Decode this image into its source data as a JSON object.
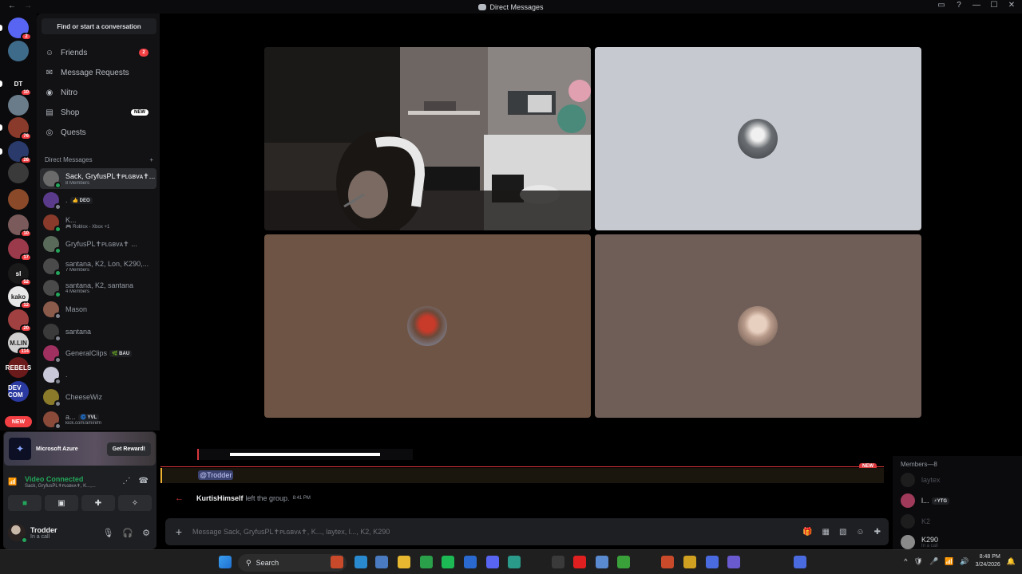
{
  "window": {
    "title": "Direct Messages",
    "back": "←",
    "forward": "→",
    "controls": [
      "▭",
      "?",
      "—",
      "☐",
      "✕"
    ]
  },
  "guilds": [
    {
      "name": "discord-home",
      "label": "",
      "badge": "2",
      "color": "#5865f2"
    },
    {
      "name": "server-globe",
      "label": "",
      "badge": "",
      "color": "#3f6b8a"
    },
    {
      "name": "server-dt",
      "label": "DT",
      "badge": "10",
      "color": "#0b0b0d"
    },
    {
      "name": "server-avatar-a",
      "label": "",
      "badge": "",
      "color": "#6a7c8a"
    },
    {
      "name": "server-avatar-b",
      "label": "",
      "badge": "76",
      "color": "#8a3a2a"
    },
    {
      "name": "server-avatar-c",
      "label": "",
      "badge": "26",
      "color": "#2a3a6a"
    },
    {
      "name": "server-avatar-d",
      "label": "",
      "badge": "",
      "color": "#3a3a3a"
    },
    {
      "name": "server-avatar-e",
      "label": "",
      "badge": "",
      "color": "#8a4a2a"
    },
    {
      "name": "server-avatar-f",
      "label": "",
      "badge": "10",
      "color": "#7a5a5a"
    },
    {
      "name": "server-avatar-g",
      "label": "",
      "badge": "17",
      "color": "#9a3a4a"
    },
    {
      "name": "server-sl",
      "label": "sl",
      "badge": "52",
      "color": "#1a1a1a"
    },
    {
      "name": "server-kako",
      "label": "kako",
      "badge": "12",
      "color": "#e8e8e8"
    },
    {
      "name": "server-avatar-h",
      "label": "",
      "badge": "20",
      "color": "#a04040"
    },
    {
      "name": "server-mlin",
      "label": "M.LIN",
      "badge": "114",
      "color": "#d0d0d0"
    },
    {
      "name": "server-rebels",
      "label": "REBELS",
      "badge": "",
      "color": "#6a1a1a"
    },
    {
      "name": "server-dev-com",
      "label": "DEV COM",
      "badge": "",
      "color": "#2a3aa0"
    }
  ],
  "new_pill": "NEW",
  "sidebar": {
    "find": "Find or start a conversation",
    "nav": [
      {
        "label": "Friends",
        "icon": "friends-icon",
        "count": "2"
      },
      {
        "label": "Message Requests",
        "icon": "mail-icon"
      },
      {
        "label": "Nitro",
        "icon": "nitro-icon"
      },
      {
        "label": "Shop",
        "icon": "shop-icon",
        "tag": "NEW"
      },
      {
        "label": "Quests",
        "icon": "quests-icon"
      }
    ],
    "dm_header": "Direct Messages",
    "dm_add": "+",
    "dms": [
      {
        "name": "Sack, GryfusPL✝ᴘʟɢʙᴠᴀ✝...",
        "sub": "8 Members",
        "tag": "",
        "color": "#6a6a6a",
        "status": "on",
        "active": true
      },
      {
        "name": ".",
        "sub": "",
        "tag": "👍 DEO",
        "color": "#5a3a8a",
        "status": "off"
      },
      {
        "name": "K...",
        "sub": "🎮 Roblox - Xbox +1",
        "tag": "",
        "color": "#8a3a2a",
        "status": "on"
      },
      {
        "name": "GryfusPL✝ᴘʟɢʙᴠᴀ✝ ...",
        "sub": "",
        "tag": "",
        "color": "#5a6a5a",
        "status": "on"
      },
      {
        "name": "santana, K2, Lon, K290,...",
        "sub": "7 Members",
        "tag": "",
        "color": "#4a4a4a",
        "status": "on"
      },
      {
        "name": "santana, K2, santana",
        "sub": "4 Members",
        "tag": "",
        "color": "#4a4a4a",
        "status": "on"
      },
      {
        "name": "Mason",
        "sub": "",
        "tag": "",
        "color": "#8a5a4a",
        "status": "off"
      },
      {
        "name": "santana",
        "sub": "",
        "tag": "",
        "color": "#3a3a3a",
        "status": "off"
      },
      {
        "name": "GeneralClips",
        "sub": "",
        "tag": "🌿 BAU",
        "color": "#a03060",
        "status": "off"
      },
      {
        "name": ".",
        "sub": "",
        "tag": "",
        "color": "#c8c8d8",
        "status": "off"
      },
      {
        "name": "CheeseWiz",
        "sub": "",
        "tag": "",
        "color": "#8a7a2a",
        "status": "off"
      },
      {
        "name": "a...",
        "sub": "kick.com/amirefn",
        "tag": "🌀 YVL",
        "color": "#8a4a3a",
        "status": "off"
      }
    ]
  },
  "promo": {
    "label": "Microsoft Azure",
    "button": "Get Reward!"
  },
  "voice": {
    "status": "Video Connected",
    "channel": "Sack, GryfusPL✝ᴘʟɢʙᴠᴀ✝, K...,..."
  },
  "user": {
    "name": "Trodder",
    "status": "In a call"
  },
  "call": {
    "tiles": [
      {
        "kind": "video",
        "bg": "#3a3633"
      },
      {
        "kind": "avatar",
        "bg": "#c6c9cf",
        "avatar_color": "#6a6e72"
      },
      {
        "kind": "avatar",
        "bg": "#6e5444",
        "avatar_color": "#8a3a2a"
      },
      {
        "kind": "avatar",
        "bg": "#6f5e58",
        "avatar_color": "#b89a8a"
      }
    ]
  },
  "chat": {
    "new_tag": "NEW",
    "mention": "@Trodder",
    "system": {
      "user": "KurtisHimself",
      "text": "left the group.",
      "time": "8:41 PM"
    },
    "composer_placeholder": "Message Sack, GryfusPL✝ᴘʟɢʙᴠᴀ✝, K..., laytex, l..., K2, K290"
  },
  "members": {
    "header": "Members—8",
    "list": [
      {
        "name": "laytex",
        "sub": "",
        "tag": "",
        "online": false,
        "color": "#3a3a3a"
      },
      {
        "name": "l...",
        "sub": "",
        "tag": "⚡YTG",
        "online": true,
        "color": "#a03a5a"
      },
      {
        "name": "K2",
        "sub": "",
        "tag": "",
        "online": false,
        "color": "#3a3a3a"
      },
      {
        "name": "K290",
        "sub": "In a call",
        "tag": "",
        "online": true,
        "color": "#8a8a8a"
      }
    ]
  },
  "taskbar": {
    "search": "Search",
    "time": "8:48 PM",
    "date": "3/24/2026",
    "tray": [
      "^",
      "🛡",
      "🎤",
      "📶",
      "🔊"
    ]
  }
}
